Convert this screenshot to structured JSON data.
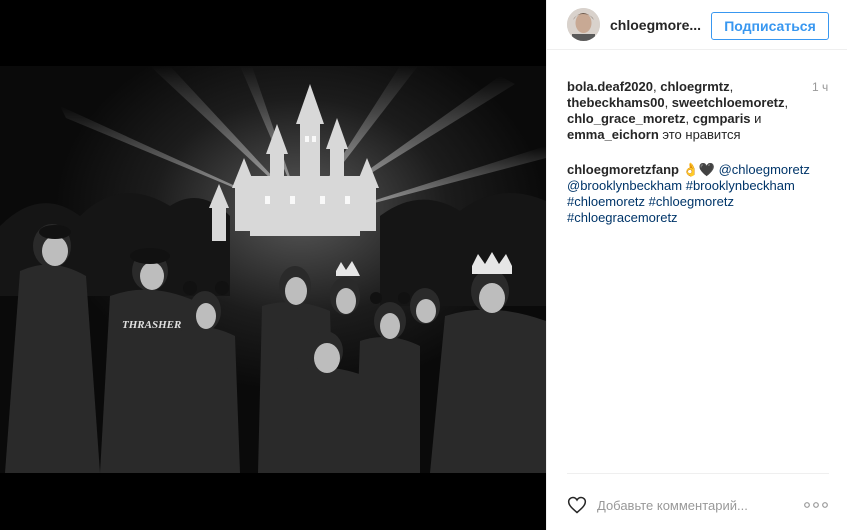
{
  "post": {
    "photo": {
      "description_icon": "photo-image",
      "shirt_text": "THRASHER"
    },
    "header": {
      "username": "chloegmore...",
      "follow_label": "Подписаться"
    },
    "likes": {
      "users": [
        "bola.deaf2020",
        "chloegrmtz",
        "thebeckhams00",
        "sweetchloemoretz",
        "chlo_grace_moretz",
        "cgmparis",
        "emma_eichorn"
      ],
      "suffix": "это нравится",
      "time": "1 ч"
    },
    "caption": {
      "author": "chloegmoretzfanp",
      "emoji": "👌🖤",
      "mentions": [
        "@chloegmoretz",
        "@brooklynbeckham"
      ],
      "hashtags": [
        "#brooklynbeckham",
        "#chloemoretz",
        "#chloegmoretz",
        "#chloegracemoretz"
      ]
    },
    "footer": {
      "comment_placeholder": "Добавьте комментарий...",
      "like_icon": "heart-outline-icon",
      "more_icon": "ellipsis-icon"
    },
    "colors": {
      "accent": "#3897f0",
      "link": "#003569",
      "text": "#262626",
      "muted": "#999999"
    }
  }
}
